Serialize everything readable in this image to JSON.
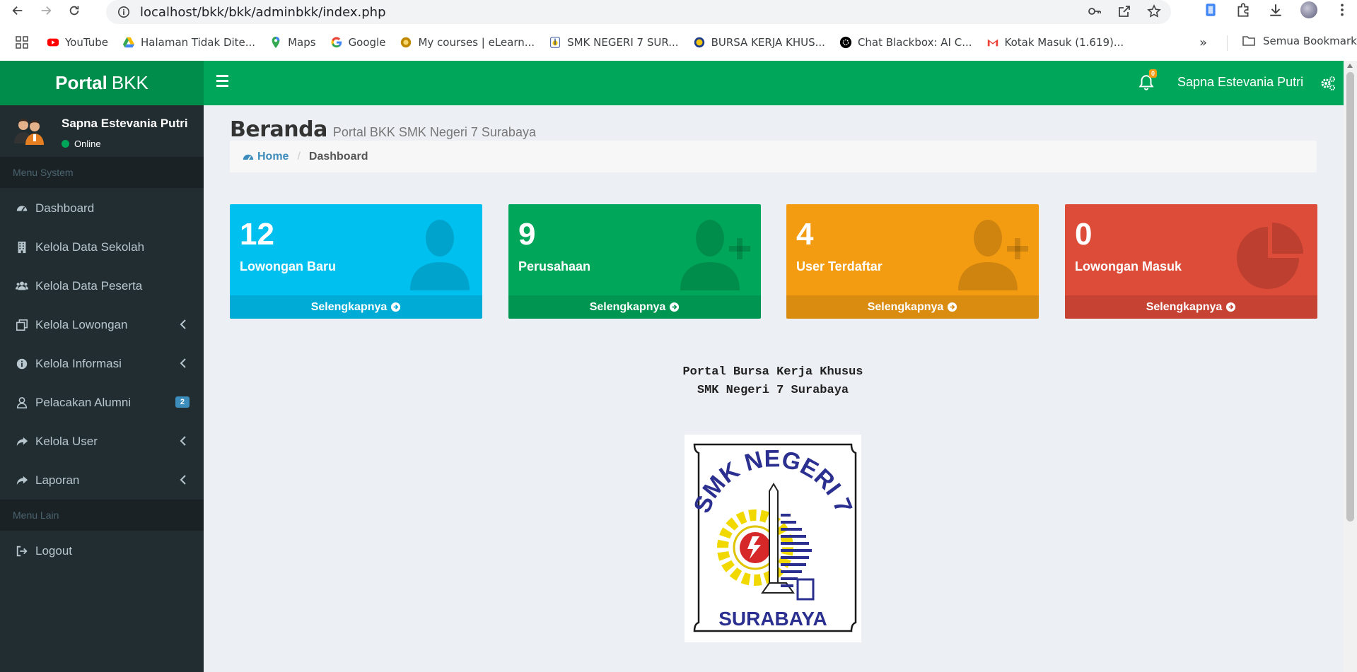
{
  "browser": {
    "url": "localhost/bkk/bkk/adminbkk/index.php",
    "bookmarks": [
      {
        "label": "YouTube",
        "icon": "youtube-icon",
        "color": "#ff0000"
      },
      {
        "label": "Halaman Tidak Dite...",
        "icon": "google-drive-icon",
        "color": "#fbbc04"
      },
      {
        "label": "Maps",
        "icon": "maps-pin-icon",
        "color": "#34a853"
      },
      {
        "label": "Google",
        "icon": "google-icon",
        "color": "#4285f4"
      },
      {
        "label": "My courses | eLearn...",
        "icon": "elearning-icon",
        "color": "#c08a00"
      },
      {
        "label": "SMK NEGERI 7 SUR...",
        "icon": "school-icon",
        "color": "#1a3c8a"
      },
      {
        "label": "BURSA KERJA KHUS...",
        "icon": "bkk-icon",
        "color": "#1a3c8a"
      },
      {
        "label": "Chat Blackbox: AI C...",
        "icon": "blackbox-icon",
        "color": "#000000"
      },
      {
        "label": "Kotak Masuk (1.619)...",
        "icon": "gmail-icon",
        "color": "#ea4335"
      }
    ],
    "all_bookmarks": "Semua Bookmark"
  },
  "app": {
    "logo_bold": "Portal",
    "logo_rest": "BKK",
    "notif_count": "0",
    "top_user": "Sapna Estevania Putri"
  },
  "sidebar": {
    "user_name": "Sapna Estevania Putri",
    "user_status": "Online",
    "header_system": "Menu System",
    "header_other": "Menu Lain",
    "items": [
      {
        "label": "Dashboard",
        "icon": "dashboard-icon"
      },
      {
        "label": "Kelola Data Sekolah",
        "icon": "building-icon"
      },
      {
        "label": "Kelola Data Peserta",
        "icon": "users-icon"
      },
      {
        "label": "Kelola Lowongan",
        "icon": "clone-icon"
      },
      {
        "label": "Kelola Informasi",
        "icon": "info-icon"
      },
      {
        "label": "Pelacakan Alumni",
        "icon": "user-outline-icon",
        "badge": "2"
      },
      {
        "label": "Kelola User",
        "icon": "share-icon"
      },
      {
        "label": "Laporan",
        "icon": "share-icon"
      },
      {
        "label": "Logout",
        "icon": "sign-out-icon"
      }
    ]
  },
  "content": {
    "title": "Beranda",
    "subtitle": "Portal BKK SMK Negeri 7 Surabaya",
    "breadcrumb_home": "Home",
    "breadcrumb_current": "Dashboard",
    "boxes": [
      {
        "value": "12",
        "label": "Lowongan Baru",
        "footer": "Selengkapnya",
        "color": "#00c0ef",
        "icon": "user-icon"
      },
      {
        "value": "9",
        "label": "Perusahaan",
        "footer": "Selengkapnya",
        "color": "#00a65a",
        "icon": "user-plus-icon"
      },
      {
        "value": "4",
        "label": "User Terdaftar",
        "footer": "Selengkapnya",
        "color": "#f39c12",
        "icon": "user-plus-icon"
      },
      {
        "value": "0",
        "label": "Lowongan Masuk",
        "footer": "Selengkapnya",
        "color": "#dd4b39",
        "icon": "pie-chart-icon"
      }
    ],
    "portal_line1": "Portal Bursa Kerja Khusus",
    "portal_line2": "SMK Negeri 7 Surabaya",
    "logo_top_text": "SMK NEGERI 7",
    "logo_bottom_text": "SURABAYA"
  }
}
